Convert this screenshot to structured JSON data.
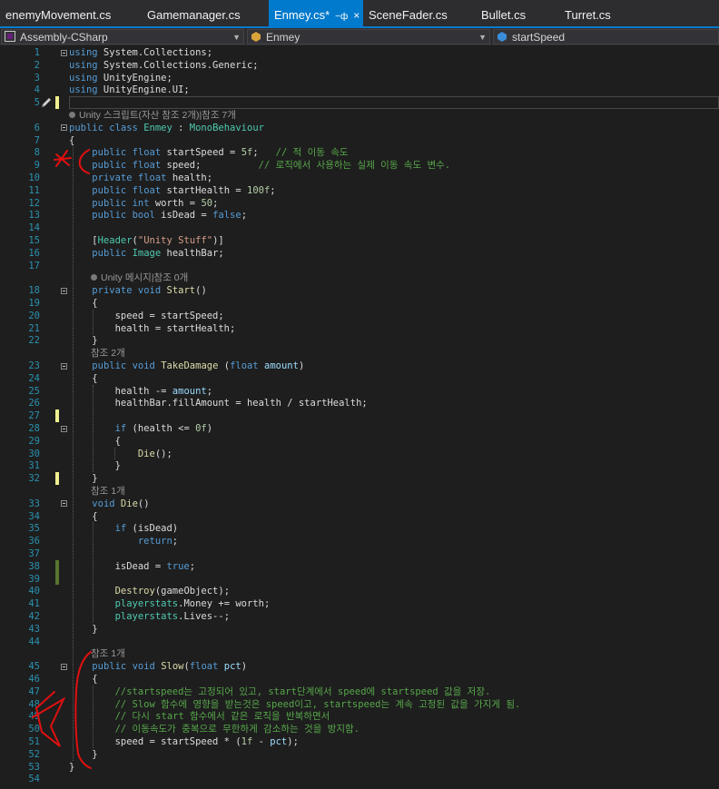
{
  "tabs": [
    {
      "label": "enemyMovement.cs"
    },
    {
      "label": "Gamemanager.cs"
    },
    {
      "label": "Enmey.cs*",
      "active": true
    },
    {
      "label": "SceneFader.cs"
    },
    {
      "label": "Bullet.cs"
    },
    {
      "label": "Turret.cs"
    }
  ],
  "navbar": {
    "project": "Assembly-CSharp",
    "class": "Enmey",
    "member": "startSpeed"
  },
  "lens": {
    "class_refs": "Unity 스크립트(자산 참조 2개)|참조 7개",
    "start_refs": "Unity 메시지|참조 0개",
    "takedamage_refs": "참조 2개",
    "die_refs": "참조 1개",
    "slow_refs": "참조 1개"
  },
  "lines": [
    {
      "n": "1",
      "t": [
        [
          "kw",
          "using"
        ],
        [
          "id",
          " System.Collections;"
        ]
      ]
    },
    {
      "n": "2",
      "t": [
        [
          "kw",
          "using"
        ],
        [
          "id",
          " System.Collections.Generic;"
        ]
      ]
    },
    {
      "n": "3",
      "t": [
        [
          "kw",
          "using"
        ],
        [
          "id",
          " UnityEngine;"
        ]
      ]
    },
    {
      "n": "4",
      "t": [
        [
          "kw",
          "using"
        ],
        [
          "id",
          " UnityEngine.UI;"
        ]
      ]
    },
    {
      "n": "5",
      "t": []
    },
    {
      "n": "6",
      "t": [
        [
          "kw",
          "public"
        ],
        [
          "id",
          " "
        ],
        [
          "kw",
          "class"
        ],
        [
          "id",
          " "
        ],
        [
          "ty",
          "Enmey"
        ],
        [
          "id",
          " : "
        ],
        [
          "ty",
          "MonoBehaviour"
        ]
      ]
    },
    {
      "n": "7",
      "t": [
        [
          "id",
          "{"
        ]
      ]
    },
    {
      "n": "8",
      "t": [
        [
          "id",
          "    "
        ],
        [
          "kw",
          "public"
        ],
        [
          "id",
          " "
        ],
        [
          "kw",
          "float"
        ],
        [
          "id",
          " startSpeed = "
        ],
        [
          "nm",
          "5f"
        ],
        [
          "id",
          ";   "
        ],
        [
          "cm",
          "// 적 이동 속도"
        ]
      ]
    },
    {
      "n": "9",
      "t": [
        [
          "id",
          "    "
        ],
        [
          "kw",
          "public"
        ],
        [
          "id",
          " "
        ],
        [
          "kw",
          "float"
        ],
        [
          "id",
          " speed;          "
        ],
        [
          "cm",
          "// 로직에서 사용하는 실제 이동 속도 변수."
        ]
      ]
    },
    {
      "n": "10",
      "t": [
        [
          "id",
          "    "
        ],
        [
          "kw",
          "private"
        ],
        [
          "id",
          " "
        ],
        [
          "kw",
          "float"
        ],
        [
          "id",
          " health;"
        ]
      ]
    },
    {
      "n": "11",
      "t": [
        [
          "id",
          "    "
        ],
        [
          "kw",
          "public"
        ],
        [
          "id",
          " "
        ],
        [
          "kw",
          "float"
        ],
        [
          "id",
          " startHealth = "
        ],
        [
          "nm",
          "100f"
        ],
        [
          "id",
          ";"
        ]
      ]
    },
    {
      "n": "12",
      "t": [
        [
          "id",
          "    "
        ],
        [
          "kw",
          "public"
        ],
        [
          "id",
          " "
        ],
        [
          "kw",
          "int"
        ],
        [
          "id",
          " worth = "
        ],
        [
          "nm",
          "50"
        ],
        [
          "id",
          ";"
        ]
      ]
    },
    {
      "n": "13",
      "t": [
        [
          "id",
          "    "
        ],
        [
          "kw",
          "public"
        ],
        [
          "id",
          " "
        ],
        [
          "kw",
          "bool"
        ],
        [
          "id",
          " isDead = "
        ],
        [
          "kw",
          "false"
        ],
        [
          "id",
          ";"
        ]
      ]
    },
    {
      "n": "14",
      "t": []
    },
    {
      "n": "15",
      "t": [
        [
          "id",
          "    ["
        ],
        [
          "ty",
          "Header"
        ],
        [
          "id",
          "("
        ],
        [
          "st",
          "\"Unity Stuff\""
        ],
        [
          "id",
          ")]"
        ]
      ]
    },
    {
      "n": "16",
      "t": [
        [
          "id",
          "    "
        ],
        [
          "kw",
          "public"
        ],
        [
          "id",
          " "
        ],
        [
          "ty",
          "Image"
        ],
        [
          "id",
          " healthBar;"
        ]
      ]
    },
    {
      "n": "17",
      "t": []
    },
    {
      "n": "18",
      "t": [
        [
          "id",
          "    "
        ],
        [
          "kw",
          "private"
        ],
        [
          "id",
          " "
        ],
        [
          "kw",
          "void"
        ],
        [
          "id",
          " "
        ],
        [
          "fn",
          "Start"
        ],
        [
          "id",
          "()"
        ]
      ]
    },
    {
      "n": "19",
      "t": [
        [
          "id",
          "    {"
        ]
      ]
    },
    {
      "n": "20",
      "t": [
        [
          "id",
          "        speed = startSpeed;"
        ]
      ]
    },
    {
      "n": "21",
      "t": [
        [
          "id",
          "        health = startHealth;"
        ]
      ]
    },
    {
      "n": "22",
      "t": [
        [
          "id",
          "    }"
        ]
      ]
    },
    {
      "n": "23",
      "t": [
        [
          "id",
          "    "
        ],
        [
          "kw",
          "public"
        ],
        [
          "id",
          " "
        ],
        [
          "kw",
          "void"
        ],
        [
          "id",
          " "
        ],
        [
          "fn",
          "TakeDamage"
        ],
        [
          "id",
          " ("
        ],
        [
          "kw",
          "float"
        ],
        [
          "id",
          " "
        ],
        [
          "pm",
          "amount"
        ],
        [
          "id",
          ")"
        ]
      ]
    },
    {
      "n": "24",
      "t": [
        [
          "id",
          "    {"
        ]
      ]
    },
    {
      "n": "25",
      "t": [
        [
          "id",
          "        health -= "
        ],
        [
          "pm",
          "amount"
        ],
        [
          "id",
          ";"
        ]
      ]
    },
    {
      "n": "26",
      "t": [
        [
          "id",
          "        healthBar.fillAmount = health / startHealth;"
        ]
      ]
    },
    {
      "n": "27",
      "t": []
    },
    {
      "n": "28",
      "t": [
        [
          "id",
          "        "
        ],
        [
          "kw",
          "if"
        ],
        [
          "id",
          " (health <= "
        ],
        [
          "nm",
          "0f"
        ],
        [
          "id",
          ")"
        ]
      ]
    },
    {
      "n": "29",
      "t": [
        [
          "id",
          "        {"
        ]
      ]
    },
    {
      "n": "30",
      "t": [
        [
          "id",
          "            "
        ],
        [
          "fn",
          "Die"
        ],
        [
          "id",
          "();"
        ]
      ]
    },
    {
      "n": "31",
      "t": [
        [
          "id",
          "        }"
        ]
      ]
    },
    {
      "n": "32",
      "t": [
        [
          "id",
          "    }"
        ]
      ]
    },
    {
      "n": "33",
      "t": [
        [
          "id",
          "    "
        ],
        [
          "kw",
          "void"
        ],
        [
          "id",
          " "
        ],
        [
          "fn",
          "Die"
        ],
        [
          "id",
          "()"
        ]
      ]
    },
    {
      "n": "34",
      "t": [
        [
          "id",
          "    {"
        ]
      ]
    },
    {
      "n": "35",
      "t": [
        [
          "id",
          "        "
        ],
        [
          "kw",
          "if"
        ],
        [
          "id",
          " (isDead)"
        ]
      ]
    },
    {
      "n": "36",
      "t": [
        [
          "id",
          "            "
        ],
        [
          "kw",
          "return"
        ],
        [
          "id",
          ";"
        ]
      ]
    },
    {
      "n": "37",
      "t": []
    },
    {
      "n": "38",
      "t": [
        [
          "id",
          "        isDead = "
        ],
        [
          "kw",
          "true"
        ],
        [
          "id",
          ";"
        ]
      ]
    },
    {
      "n": "39",
      "t": []
    },
    {
      "n": "40",
      "t": [
        [
          "id",
          "        "
        ],
        [
          "fn",
          "Destroy"
        ],
        [
          "id",
          "(gameObject);"
        ]
      ]
    },
    {
      "n": "41",
      "t": [
        [
          "id",
          "        "
        ],
        [
          "ty",
          "playerstats"
        ],
        [
          "id",
          ".Money += worth;"
        ]
      ]
    },
    {
      "n": "42",
      "t": [
        [
          "id",
          "        "
        ],
        [
          "ty",
          "playerstats"
        ],
        [
          "id",
          ".Lives--;"
        ]
      ]
    },
    {
      "n": "43",
      "t": [
        [
          "id",
          "    }"
        ]
      ]
    },
    {
      "n": "44",
      "t": []
    },
    {
      "n": "45",
      "t": [
        [
          "id",
          "    "
        ],
        [
          "kw",
          "public"
        ],
        [
          "id",
          " "
        ],
        [
          "kw",
          "void"
        ],
        [
          "id",
          " "
        ],
        [
          "fn",
          "Slow"
        ],
        [
          "id",
          "("
        ],
        [
          "kw",
          "float"
        ],
        [
          "id",
          " "
        ],
        [
          "pm",
          "pct"
        ],
        [
          "id",
          ")"
        ]
      ]
    },
    {
      "n": "46",
      "t": [
        [
          "id",
          "    {"
        ]
      ]
    },
    {
      "n": "47",
      "t": [
        [
          "id",
          "        "
        ],
        [
          "cm",
          "//startspeed는 고정되어 있고, start단계에서 speed에 startspeed 값을 저장."
        ]
      ]
    },
    {
      "n": "48",
      "t": [
        [
          "id",
          "        "
        ],
        [
          "cm",
          "// Slow 함수에 영향을 받는것은 speed이고, startspeed는 계속 고정된 값을 가지게 됨."
        ]
      ]
    },
    {
      "n": "49",
      "t": [
        [
          "id",
          "        "
        ],
        [
          "cm",
          "// 다시 start 함수에서 같은 로직을 반복하면서"
        ]
      ]
    },
    {
      "n": "50",
      "t": [
        [
          "id",
          "        "
        ],
        [
          "cm",
          "// 이동속도가 중복으로 무한하게 감소하는 것을 방지함."
        ]
      ]
    },
    {
      "n": "51",
      "t": [
        [
          "id",
          "        speed = startSpeed * ("
        ],
        [
          "nm",
          "1f"
        ],
        [
          "id",
          " - "
        ],
        [
          "pm",
          "pct"
        ],
        [
          "id",
          ");"
        ]
      ]
    },
    {
      "n": "52",
      "t": [
        [
          "id",
          "    }"
        ]
      ]
    },
    {
      "n": "53",
      "t": [
        [
          "id",
          "}"
        ]
      ]
    },
    {
      "n": "54",
      "t": []
    }
  ]
}
